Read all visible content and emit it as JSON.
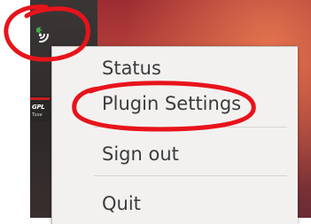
{
  "tray": {
    "icon": "wireless-signal-icon"
  },
  "panel": {
    "app_logo_text": "GPL",
    "app_logo_sub": "Tuxe"
  },
  "menu": {
    "items": [
      {
        "label": "Status"
      },
      {
        "label": "Plugin Settings"
      },
      {
        "label": "Sign out"
      },
      {
        "label": "Quit"
      }
    ]
  },
  "colors": {
    "annotation": "#e8131b",
    "menu_bg": "#f2f1f0",
    "menu_text": "#3c3c3c",
    "panel": "#2f2b2b",
    "wallpaper": "#a8363a"
  }
}
